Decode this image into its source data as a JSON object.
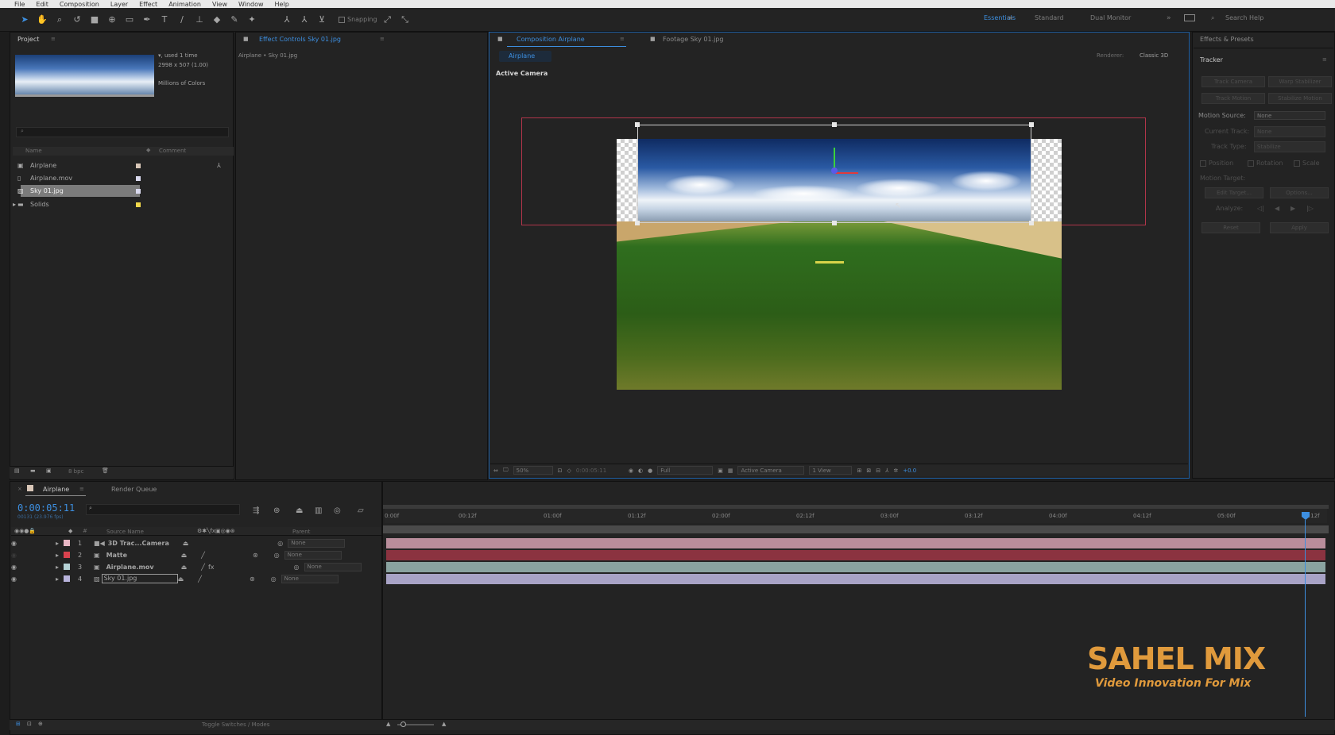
{
  "menu": [
    "File",
    "Edit",
    "Composition",
    "Layer",
    "Effect",
    "Animation",
    "View",
    "Window",
    "Help"
  ],
  "toolbar": {
    "snapping_label": "Snapping"
  },
  "workspaces": {
    "essentials": "Essentials",
    "standard": "Standard",
    "dual_monitor": "Dual Monitor",
    "search_placeholder": "Search Help"
  },
  "project": {
    "tab": "Project",
    "info_line1": "▾, used 1 time",
    "info_line2": "2998 x 507 (1.00)",
    "info_line3": "Millions of Colors",
    "col_name": "Name",
    "col_comment": "Comment",
    "items": [
      {
        "name": "Airplane",
        "type": "composition",
        "color": "#d9c7b8"
      },
      {
        "name": "Airplane.mov",
        "type": "footage",
        "color": "#d9d9ee"
      },
      {
        "name": "Sky 01.jpg",
        "type": "image",
        "color": "#d9d9ee"
      },
      {
        "name": "Solids",
        "type": "folder",
        "color": "#f2d84b"
      }
    ],
    "footer_bpc": "8 bpc"
  },
  "effect_controls": {
    "tab": "Effect Controls Sky 01.jpg",
    "breadcrumb": "Airplane • Sky 01.jpg"
  },
  "composition": {
    "tab": "Composition Airplane",
    "footage_tab": "Footage Sky 01.jpg",
    "sub_tab": "Airplane",
    "renderer_label": "Renderer:",
    "renderer_value": "Classic 3D",
    "view_label": "Active Camera",
    "footer": {
      "zoom": "50%",
      "timecode": "0:00:05:11",
      "resolution": "Full",
      "camera": "Active Camera",
      "views": "1 View",
      "exposure": "+0.0"
    }
  },
  "tracker": {
    "effects_tab": "Effects & Presets",
    "tab": "Tracker",
    "track_camera": "Track Camera",
    "warp_stabilizer": "Warp Stabilizer",
    "track_motion": "Track Motion",
    "stabilize_motion": "Stabilize Motion",
    "motion_source_label": "Motion Source:",
    "motion_source_value": "None",
    "current_track_label": "Current Track:",
    "current_track_value": "None",
    "track_type_label": "Track Type:",
    "track_type_value": "Stabilize",
    "position": "Position",
    "rotation": "Rotation",
    "scale": "Scale",
    "motion_target": "Motion Target:",
    "edit_target": "Edit Target...",
    "options": "Options...",
    "analyze": "Analyze:",
    "reset": "Reset",
    "apply": "Apply"
  },
  "timeline": {
    "tab": "Airplane",
    "render_queue": "Render Queue",
    "timecode": "0:00:05:11",
    "frames": "00131 (23.976 fps)",
    "col_source": "Source Name",
    "col_parent": "Parent",
    "ruler": [
      "0:00f",
      "00:12f",
      "01:00f",
      "01:12f",
      "02:00f",
      "02:12f",
      "03:00f",
      "03:12f",
      "04:00f",
      "04:12f",
      "05:00f",
      "05:12f"
    ],
    "layers": [
      {
        "num": "1",
        "name": "3D Trac...Camera",
        "color": "#e8b7c4",
        "parent": "None",
        "bar": "#b98d9b"
      },
      {
        "num": "2",
        "name": "Matte",
        "color": "#d9424e",
        "parent": "None",
        "bar": "#8b3340"
      },
      {
        "num": "3",
        "name": "Airplane.mov",
        "color": "#b6d3d6",
        "parent": "None",
        "bar": "#8aa3a0"
      },
      {
        "num": "4",
        "name": "Sky 01.jpg",
        "color": "#b9b4dc",
        "parent": "None",
        "bar": "#a8a3c6"
      }
    ],
    "footer_label": "Toggle Switches / Modes"
  },
  "watermark": {
    "title": "SAHEL MIX",
    "subtitle": "Video Innovation For Mix"
  }
}
